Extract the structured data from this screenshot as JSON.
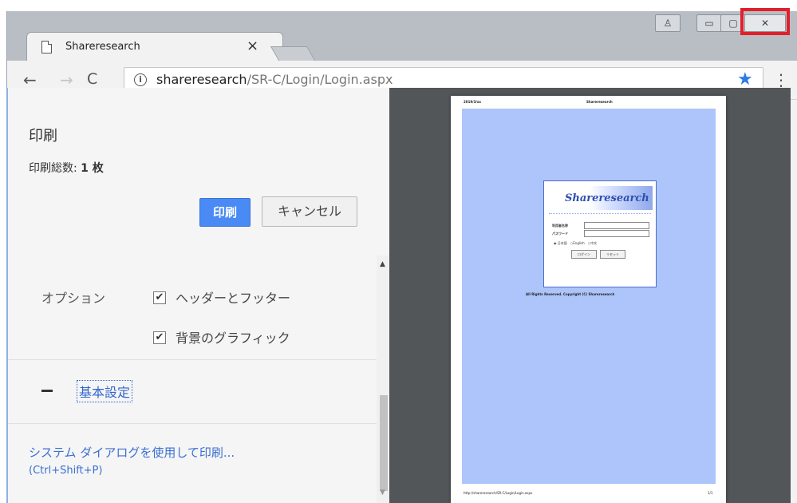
{
  "browser": {
    "tab_title": "Shareresearch",
    "tab_close": "×",
    "url_host": "shareresearch",
    "url_path": "/SR-C/Login/Login.aspx",
    "accent_color": "#2d7be5"
  },
  "window_controls": {
    "user": "♙",
    "minimize": "▭",
    "maximize": "▢",
    "close": "✕",
    "highlight_color": "#e0202a"
  },
  "print_panel": {
    "title": "印刷",
    "total_label": "印刷総数: ",
    "total_value": "1 枚",
    "print_button": "印刷",
    "cancel_button": "キャンセル",
    "options_label": "オプション",
    "option_header_footer": "ヘッダーとフッター",
    "option_header_footer_checked": true,
    "option_background": "背景のグラフィック",
    "option_background_checked": true,
    "basic_settings_toggle": "−",
    "basic_settings": "基本設定",
    "system_dialog_link": "システム ダイアログを使用して印刷...",
    "system_dialog_shortcut": "(Ctrl+Shift+P)",
    "print_button_color": "#4a8af4"
  },
  "preview": {
    "header_left": "2019/3/xx",
    "header_right": "Shareresearch",
    "logo": "Shareresearch",
    "field1_label": "利用者名称",
    "field2_label": "パスワード",
    "language_options": "◉ 日本語　○English　○中文",
    "login_button": "ログイン",
    "reset_button": "リセット",
    "copyright": "All Rights Reserved. Copyright (C) Shareresearch",
    "footer_left": "http://shareresearch/SR-C/Login/Login.aspx",
    "footer_right": "1/1",
    "background_color": "#aec5fb"
  }
}
